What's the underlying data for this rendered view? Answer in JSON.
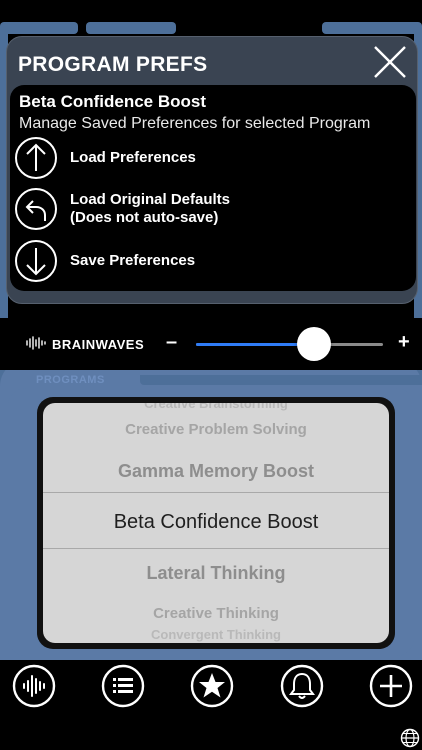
{
  "modal": {
    "title": "PROGRAM PREFS",
    "program_name": "Beta Confidence Boost",
    "subtitle": "Manage Saved Preferences for selected Program",
    "actions": [
      {
        "label": "Load Preferences",
        "icon": "arrow-up-circle-icon"
      },
      {
        "label": "Load Original Defaults",
        "label2": "(Does not auto-save)",
        "icon": "undo-circle-icon"
      },
      {
        "label": "Save Preferences",
        "icon": "arrow-down-circle-icon"
      }
    ]
  },
  "brainwaves": {
    "label": "BRAINWAVES",
    "minus": "–",
    "plus": "+",
    "value": 0.63,
    "accent": "#2f7cf6"
  },
  "programs_label": "PROGRAMS",
  "picker": {
    "items": [
      "Creative Brainstorming",
      "Creative Problem Solving",
      "Gamma Memory Boost",
      "Beta Confidence Boost",
      "Lateral Thinking",
      "Creative Thinking",
      "Convergent Thinking"
    ],
    "selected_index": 3
  },
  "tabbar": {
    "items": [
      "waveform-icon",
      "list-icon",
      "star-icon",
      "bell-icon",
      "plus-icon"
    ]
  },
  "colors": {
    "frame_blue": "#5b7aa6",
    "modal_bg": "#3a4452"
  }
}
